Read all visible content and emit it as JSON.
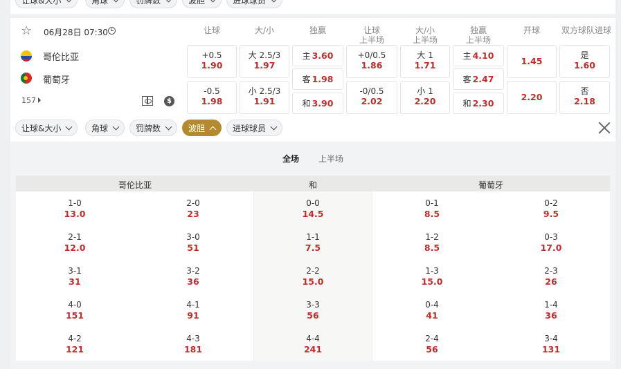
{
  "filters_top": [
    {
      "label": "让球&大小"
    },
    {
      "label": "角球"
    },
    {
      "label": "罚牌数"
    },
    {
      "label": "波胆"
    },
    {
      "label": "进球球员"
    }
  ],
  "match": {
    "date_time": "06月28日 07:30",
    "home": "哥伦比亚",
    "away": "葡萄牙",
    "more_count": "157",
    "icons": [
      "star-icon",
      "clock-icon",
      "pitch-icon",
      "dollar-icon"
    ]
  },
  "columns": [
    "让球",
    "大/小",
    "独赢",
    "让球\n上半场",
    "大/小\n上半场",
    "独赢\n上半场",
    "开球",
    "双方球队进球"
  ],
  "odds": {
    "handicap": [
      {
        "line": "+0.5",
        "odd": "1.90"
      },
      {
        "line": "-0.5",
        "odd": "1.98"
      }
    ],
    "over_under": [
      {
        "line": "大 2.5/3",
        "odd": "1.97"
      },
      {
        "line": "小 2.5/3",
        "odd": "1.91"
      }
    ],
    "moneyline": [
      {
        "label": "主",
        "odd": "3.60"
      },
      {
        "label": "客",
        "odd": "1.98"
      },
      {
        "label": "和",
        "odd": "3.90"
      }
    ],
    "handicap_half": [
      {
        "line": "+0/0.5",
        "odd": "1.86"
      },
      {
        "line": "-0/0.5",
        "odd": "2.02"
      }
    ],
    "over_under_half": [
      {
        "line": "大 1",
        "odd": "1.71"
      },
      {
        "line": "小 1",
        "odd": "2.20"
      }
    ],
    "moneyline_half": [
      {
        "label": "主",
        "odd": "4.10"
      },
      {
        "label": "客",
        "odd": "2.47"
      },
      {
        "label": "和",
        "odd": "2.30"
      }
    ],
    "kickoff": [
      "1.45",
      "2.20"
    ],
    "btts": [
      {
        "label": "是",
        "odd": "1.60"
      },
      {
        "label": "否",
        "odd": "2.18"
      }
    ]
  },
  "filters": [
    {
      "label": "让球&大小",
      "active": false
    },
    {
      "label": "角球",
      "active": false
    },
    {
      "label": "罚牌数",
      "active": false
    },
    {
      "label": "波胆",
      "active": true
    },
    {
      "label": "进球球员",
      "active": false
    }
  ],
  "tabs": [
    "全场",
    "上半场"
  ],
  "correct_score": {
    "headers": [
      "哥伦比亚",
      "和",
      "葡萄牙"
    ],
    "rows": [
      [
        {
          "score": "1-0",
          "odd": "13.0"
        },
        {
          "score": "2-0",
          "odd": "23"
        },
        {
          "score": "0-0",
          "odd": "14.5"
        },
        {
          "score": "0-1",
          "odd": "8.5"
        },
        {
          "score": "0-2",
          "odd": "9.5"
        }
      ],
      [
        {
          "score": "2-1",
          "odd": "12.0"
        },
        {
          "score": "3-0",
          "odd": "51"
        },
        {
          "score": "1-1",
          "odd": "7.5"
        },
        {
          "score": "1-2",
          "odd": "8.5"
        },
        {
          "score": "0-3",
          "odd": "17.0"
        }
      ],
      [
        {
          "score": "3-1",
          "odd": "31"
        },
        {
          "score": "3-2",
          "odd": "36"
        },
        {
          "score": "2-2",
          "odd": "15.0"
        },
        {
          "score": "1-3",
          "odd": "15.0"
        },
        {
          "score": "2-3",
          "odd": "26"
        }
      ],
      [
        {
          "score": "4-0",
          "odd": "151"
        },
        {
          "score": "4-1",
          "odd": "91"
        },
        {
          "score": "3-3",
          "odd": "56"
        },
        {
          "score": "0-4",
          "odd": "41"
        },
        {
          "score": "1-4",
          "odd": "36"
        }
      ],
      [
        {
          "score": "4-2",
          "odd": "121"
        },
        {
          "score": "4-3",
          "odd": "181"
        },
        {
          "score": "4-4",
          "odd": "241"
        },
        {
          "score": "2-4",
          "odd": "56"
        },
        {
          "score": "3-4",
          "odd": "131"
        }
      ]
    ]
  },
  "colors": {
    "accent": "#b38b2e",
    "odd_red": "#c42b2b"
  }
}
